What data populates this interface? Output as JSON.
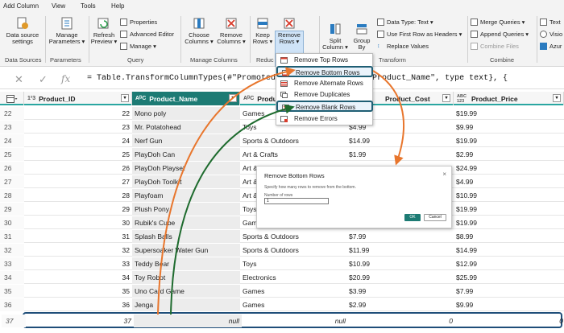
{
  "menu_bar": [
    "Add Column",
    "View",
    "Tools",
    "Help"
  ],
  "ribbon": {
    "data_source_settings": [
      "Data source",
      "settings"
    ],
    "manage_parameters": [
      "Manage",
      "Parameters ▾"
    ],
    "refresh_preview": [
      "Refresh",
      "Preview ▾"
    ],
    "properties": "Properties",
    "advanced_editor": "Advanced Editor",
    "manage": "Manage ▾",
    "choose_columns": [
      "Choose",
      "Columns ▾"
    ],
    "remove_columns": [
      "Remove",
      "Columns ▾"
    ],
    "keep_rows": [
      "Keep",
      "Rows ▾"
    ],
    "remove_rows": [
      "Remove",
      "Rows ▾"
    ],
    "split_column": [
      "Split",
      "Column ▾"
    ],
    "group_by": [
      "Group",
      "By"
    ],
    "data_type": "Data Type: Text ▾",
    "use_first_row": "Use First Row as Headers ▾",
    "replace_values": "Replace Values",
    "merge_queries": "Merge Queries ▾",
    "append_queries": "Append Queries ▾",
    "combine_files": "Combine Files",
    "text": "Text",
    "vision": "Visio",
    "azure": "Azur",
    "groups": {
      "data_sources": "Data Sources",
      "parameters": "Parameters",
      "query": "Query",
      "manage_columns": "Manage Columns",
      "reduce": "Reduc",
      "transform": "Transform",
      "combine": "Combine"
    }
  },
  "formula_bar": {
    "cancel": "✕",
    "confirm": "✓",
    "fx": "fx",
    "formula": "= Table.TransformColumnTypes(#\"Promoted Hea                    Int64.Type}, {\"Product_Name\", type text}, {"
  },
  "columns": [
    {
      "type": "1²3",
      "name": "Product_ID"
    },
    {
      "type": "AᴮC",
      "name": "Product_Name"
    },
    {
      "type": "AᴮC",
      "name": "Produ"
    },
    {
      "type": "",
      "name": "Product_Cost"
    },
    {
      "type": "ABC 123",
      "name": "Product_Price"
    }
  ],
  "rows": [
    {
      "n": "22",
      "id": "22",
      "name": "Mono poly",
      "cat": "Games",
      "cost": "",
      "price": "$19.99"
    },
    {
      "n": "23",
      "id": "23",
      "name": "Mr. Potatohead",
      "cat": "Toys",
      "cost": "$4.99",
      "price": "$9.99"
    },
    {
      "n": "24",
      "id": "24",
      "name": "Nerf Gun",
      "cat": "Sports & Outdoors",
      "cost": "$14.99",
      "price": "$19.99"
    },
    {
      "n": "25",
      "id": "25",
      "name": "PlayDoh Can",
      "cat": "Art & Crafts",
      "cost": "$1.99",
      "price": "$2.99"
    },
    {
      "n": "26",
      "id": "26",
      "name": "PlayDoh Playset",
      "cat": "Art &",
      "cost": "",
      "price": "$24.99"
    },
    {
      "n": "27",
      "id": "27",
      "name": "PlayDoh Toolkit",
      "cat": "Art &",
      "cost": "",
      "price": "$4.99"
    },
    {
      "n": "28",
      "id": "28",
      "name": "Playfoam",
      "cat": "Art &",
      "cost": "",
      "price": "$10.99"
    },
    {
      "n": "29",
      "id": "29",
      "name": "Plush Pony",
      "cat": "Toys",
      "cost": "",
      "price": "$19.99"
    },
    {
      "n": "30",
      "id": "30",
      "name": "Rubik's Cube",
      "cat": "Gam",
      "cost": "",
      "price": "$19.99"
    },
    {
      "n": "31",
      "id": "31",
      "name": "Splash Balls",
      "cat": "Sports & Outdoors",
      "cost": "$7.99",
      "price": "$8.99"
    },
    {
      "n": "32",
      "id": "32",
      "name": "Supersoaker Water Gun",
      "cat": "Sports & Outdoors",
      "cost": "$11.99",
      "price": "$14.99"
    },
    {
      "n": "33",
      "id": "33",
      "name": "Teddy Bear",
      "cat": "Toys",
      "cost": "$10.99",
      "price": "$12.99"
    },
    {
      "n": "34",
      "id": "34",
      "name": "Toy Robot",
      "cat": "Electronics",
      "cost": "$20.99",
      "price": "$25.99"
    },
    {
      "n": "35",
      "id": "35",
      "name": "Uno Card Game",
      "cat": "Games",
      "cost": "$3.99",
      "price": "$7.99"
    },
    {
      "n": "36",
      "id": "36",
      "name": "Jenga",
      "cat": "Games",
      "cost": "$2.99",
      "price": "$9.99"
    },
    {
      "n": "37",
      "id": "37",
      "name": "null",
      "cat": "null",
      "cost": "0",
      "price": "0"
    }
  ],
  "remove_rows_menu": [
    "Remove Top Rows",
    "Remove Bottom Rows",
    "Remove Alternate Rows",
    "Remove Duplicates",
    "Remove Blank Rows",
    "Remove Errors"
  ],
  "dialog": {
    "title": "Remove Bottom Rows",
    "close": "×",
    "description": "Specify how many rows to remove from the bottom.",
    "label": "Number of rows",
    "value": "1",
    "ok": "OK",
    "cancel": "Cancel"
  },
  "colors": {
    "accent": "#1d7b74",
    "arrow_orange": "#e8762d",
    "arrow_green": "#1e6b2e",
    "highlight_border": "#1f4e79"
  }
}
